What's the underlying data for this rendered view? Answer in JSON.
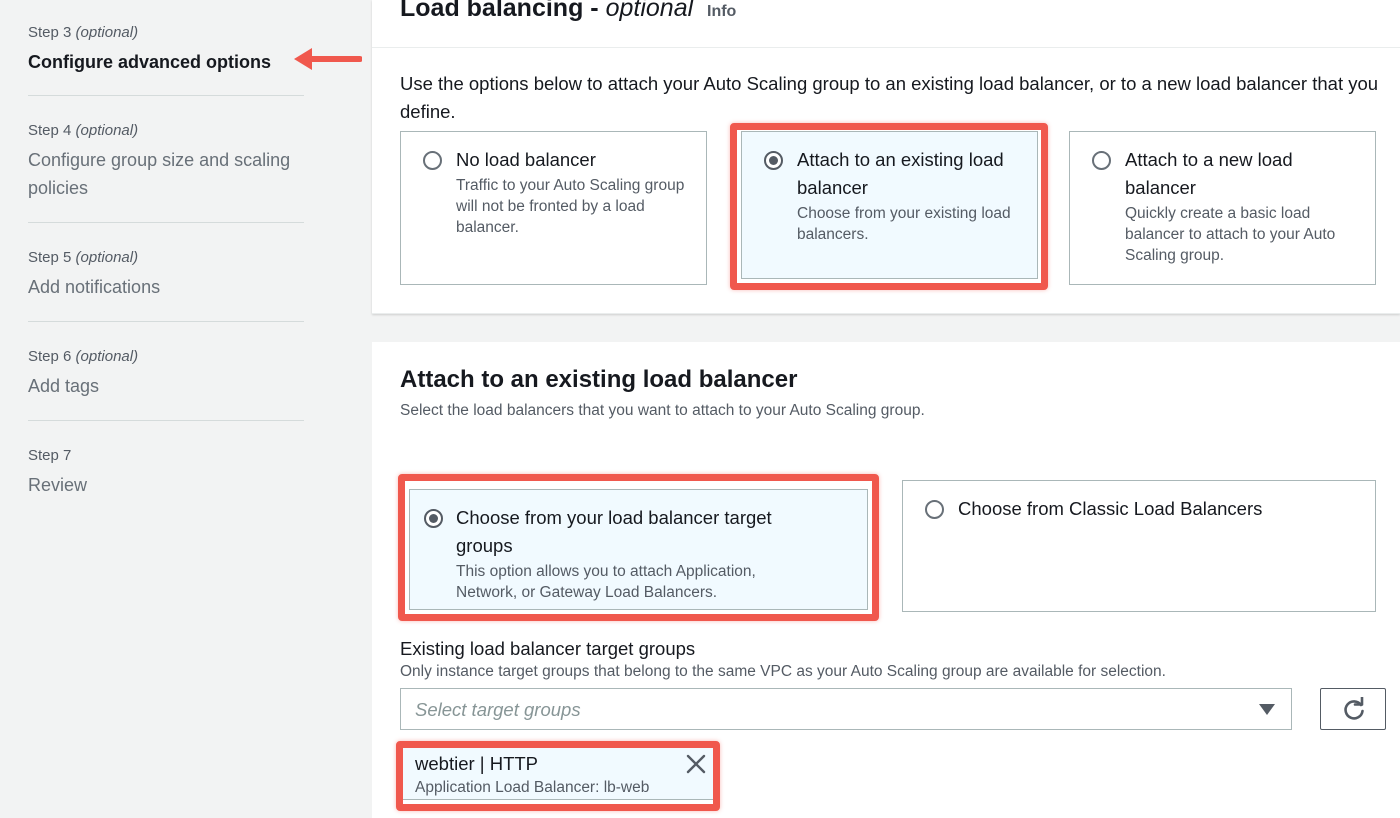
{
  "sidebar": {
    "steps": [
      {
        "num": "Step 3",
        "optional": "(optional)",
        "title": "Configure advanced options"
      },
      {
        "num": "Step 4",
        "optional": "(optional)",
        "title": "Configure group size and scaling policies"
      },
      {
        "num": "Step 5",
        "optional": "(optional)",
        "title": "Add notifications"
      },
      {
        "num": "Step 6",
        "optional": "(optional)",
        "title": "Add tags"
      },
      {
        "num": "Step 7",
        "optional": "",
        "title": "Review"
      }
    ]
  },
  "load_balancing": {
    "title": "Load balancing - ",
    "title_optional": "optional",
    "info": "Info",
    "description": "Use the options below to attach your Auto Scaling group to an existing load balancer, or to a new load balancer that you define.",
    "options": [
      {
        "title": "No load balancer",
        "desc": "Traffic to your Auto Scaling group will not be fronted by a load balancer.",
        "selected": false
      },
      {
        "title": "Attach to an existing load balancer",
        "desc": "Choose from your existing load balancers.",
        "selected": true
      },
      {
        "title": "Attach to a new load balancer",
        "desc": "Quickly create a basic load balancer to attach to your Auto Scaling group.",
        "selected": false
      }
    ]
  },
  "existing_lb": {
    "title": "Attach to an existing load balancer",
    "description": "Select the load balancers that you want to attach to your Auto Scaling group.",
    "options": [
      {
        "title": "Choose from your load balancer target groups",
        "desc": "This option allows you to attach Application, Network, or Gateway Load Balancers.",
        "selected": true
      },
      {
        "title": "Choose from Classic Load Balancers",
        "desc": "",
        "selected": false
      }
    ],
    "target_groups_label": "Existing load balancer target groups",
    "target_groups_desc": "Only instance target groups that belong to the same VPC as your Auto Scaling group are available for selection.",
    "select_placeholder": "Select target groups",
    "token": {
      "title": "webtier | HTTP",
      "subtitle": "Application Load Balancer: lb-web"
    }
  },
  "colors": {
    "highlight": "#f0584d",
    "selected_tile_bg": "#f1faff"
  },
  "icons": [
    "radio-icon",
    "caret-down-icon",
    "refresh-icon",
    "close-icon",
    "arrow-left-icon"
  ]
}
